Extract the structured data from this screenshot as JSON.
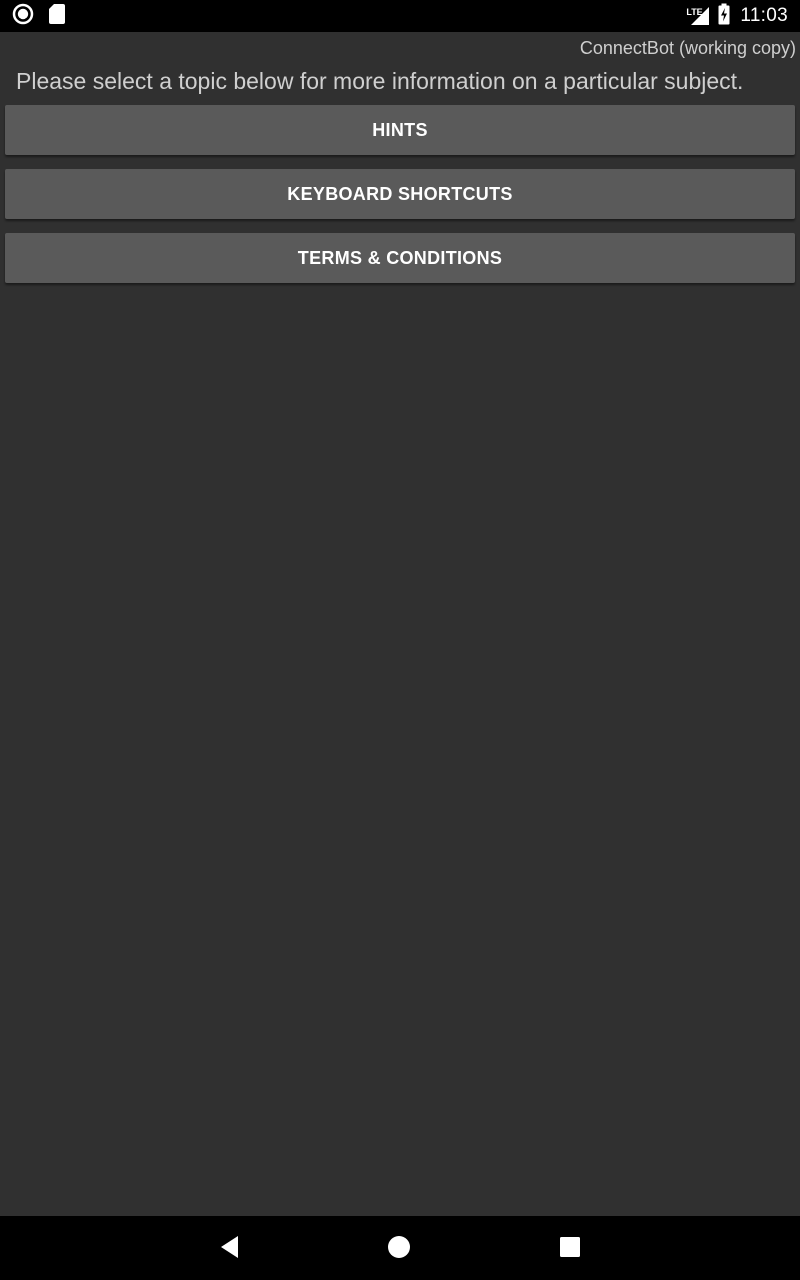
{
  "status_bar": {
    "left_icons": [
      "record-circle-icon",
      "sd-card-icon"
    ],
    "network_label": "LTE",
    "right_icons": [
      "signal-icon",
      "battery-charging-icon"
    ],
    "time": "11:03"
  },
  "app": {
    "title": "ConnectBot (working copy)",
    "instructions": "Please select a topic below for more information on a particular subject."
  },
  "topics": {
    "hints": "HINTS",
    "keyboard_shortcuts": "KEYBOARD SHORTCUTS",
    "terms": "TERMS & CONDITIONS"
  },
  "nav_bar": {
    "icons": [
      "back-icon",
      "home-icon",
      "recents-icon"
    ]
  },
  "colors": {
    "background": "#303030",
    "button": "#5a5a5a",
    "text_secondary": "#cfcfcf",
    "bars": "#000000"
  }
}
